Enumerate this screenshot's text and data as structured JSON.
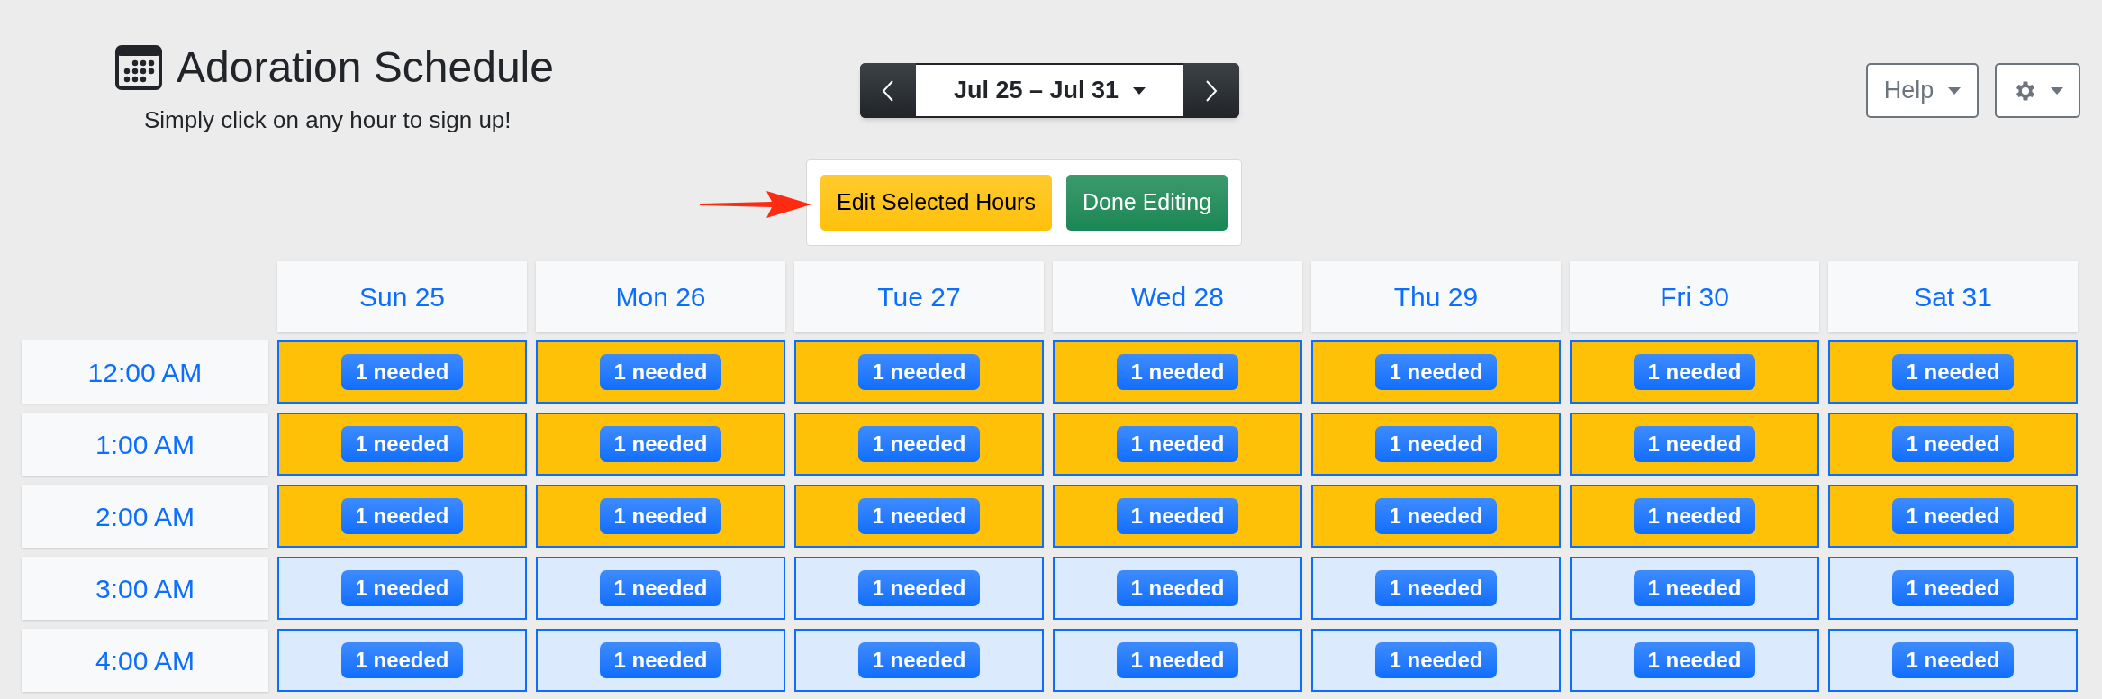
{
  "header": {
    "title": "Adoration Schedule",
    "subtitle": "Simply click on any hour to sign up!"
  },
  "week_picker": {
    "label": "Jul 25 – Jul 31"
  },
  "help_button": {
    "label": "Help"
  },
  "edit_panel": {
    "edit_button": "Edit Selected Hours",
    "done_button": "Done Editing"
  },
  "days": [
    "Sun 25",
    "Mon 26",
    "Tue 27",
    "Wed 28",
    "Thu 29",
    "Fri 30",
    "Sat 31"
  ],
  "rows": [
    {
      "time": "12:00 AM",
      "cells": [
        {
          "badge": "1 needed",
          "selected": true
        },
        {
          "badge": "1 needed",
          "selected": true
        },
        {
          "badge": "1 needed",
          "selected": true
        },
        {
          "badge": "1 needed",
          "selected": true
        },
        {
          "badge": "1 needed",
          "selected": true
        },
        {
          "badge": "1 needed",
          "selected": true
        },
        {
          "badge": "1 needed",
          "selected": true
        }
      ]
    },
    {
      "time": "1:00 AM",
      "cells": [
        {
          "badge": "1 needed",
          "selected": true
        },
        {
          "badge": "1 needed",
          "selected": true
        },
        {
          "badge": "1 needed",
          "selected": true
        },
        {
          "badge": "1 needed",
          "selected": true
        },
        {
          "badge": "1 needed",
          "selected": true
        },
        {
          "badge": "1 needed",
          "selected": true
        },
        {
          "badge": "1 needed",
          "selected": true
        }
      ]
    },
    {
      "time": "2:00 AM",
      "cells": [
        {
          "badge": "1 needed",
          "selected": true
        },
        {
          "badge": "1 needed",
          "selected": true
        },
        {
          "badge": "1 needed",
          "selected": true
        },
        {
          "badge": "1 needed",
          "selected": true
        },
        {
          "badge": "1 needed",
          "selected": true
        },
        {
          "badge": "1 needed",
          "selected": true
        },
        {
          "badge": "1 needed",
          "selected": true
        }
      ]
    },
    {
      "time": "3:00 AM",
      "cells": [
        {
          "badge": "1 needed",
          "selected": false
        },
        {
          "badge": "1 needed",
          "selected": false
        },
        {
          "badge": "1 needed",
          "selected": false
        },
        {
          "badge": "1 needed",
          "selected": false
        },
        {
          "badge": "1 needed",
          "selected": false
        },
        {
          "badge": "1 needed",
          "selected": false
        },
        {
          "badge": "1 needed",
          "selected": false
        }
      ]
    },
    {
      "time": "4:00 AM",
      "cells": [
        {
          "badge": "1 needed",
          "selected": false
        },
        {
          "badge": "1 needed",
          "selected": false
        },
        {
          "badge": "1 needed",
          "selected": false
        },
        {
          "badge": "1 needed",
          "selected": false
        },
        {
          "badge": "1 needed",
          "selected": false
        },
        {
          "badge": "1 needed",
          "selected": false
        },
        {
          "badge": "1 needed",
          "selected": false
        }
      ]
    }
  ]
}
